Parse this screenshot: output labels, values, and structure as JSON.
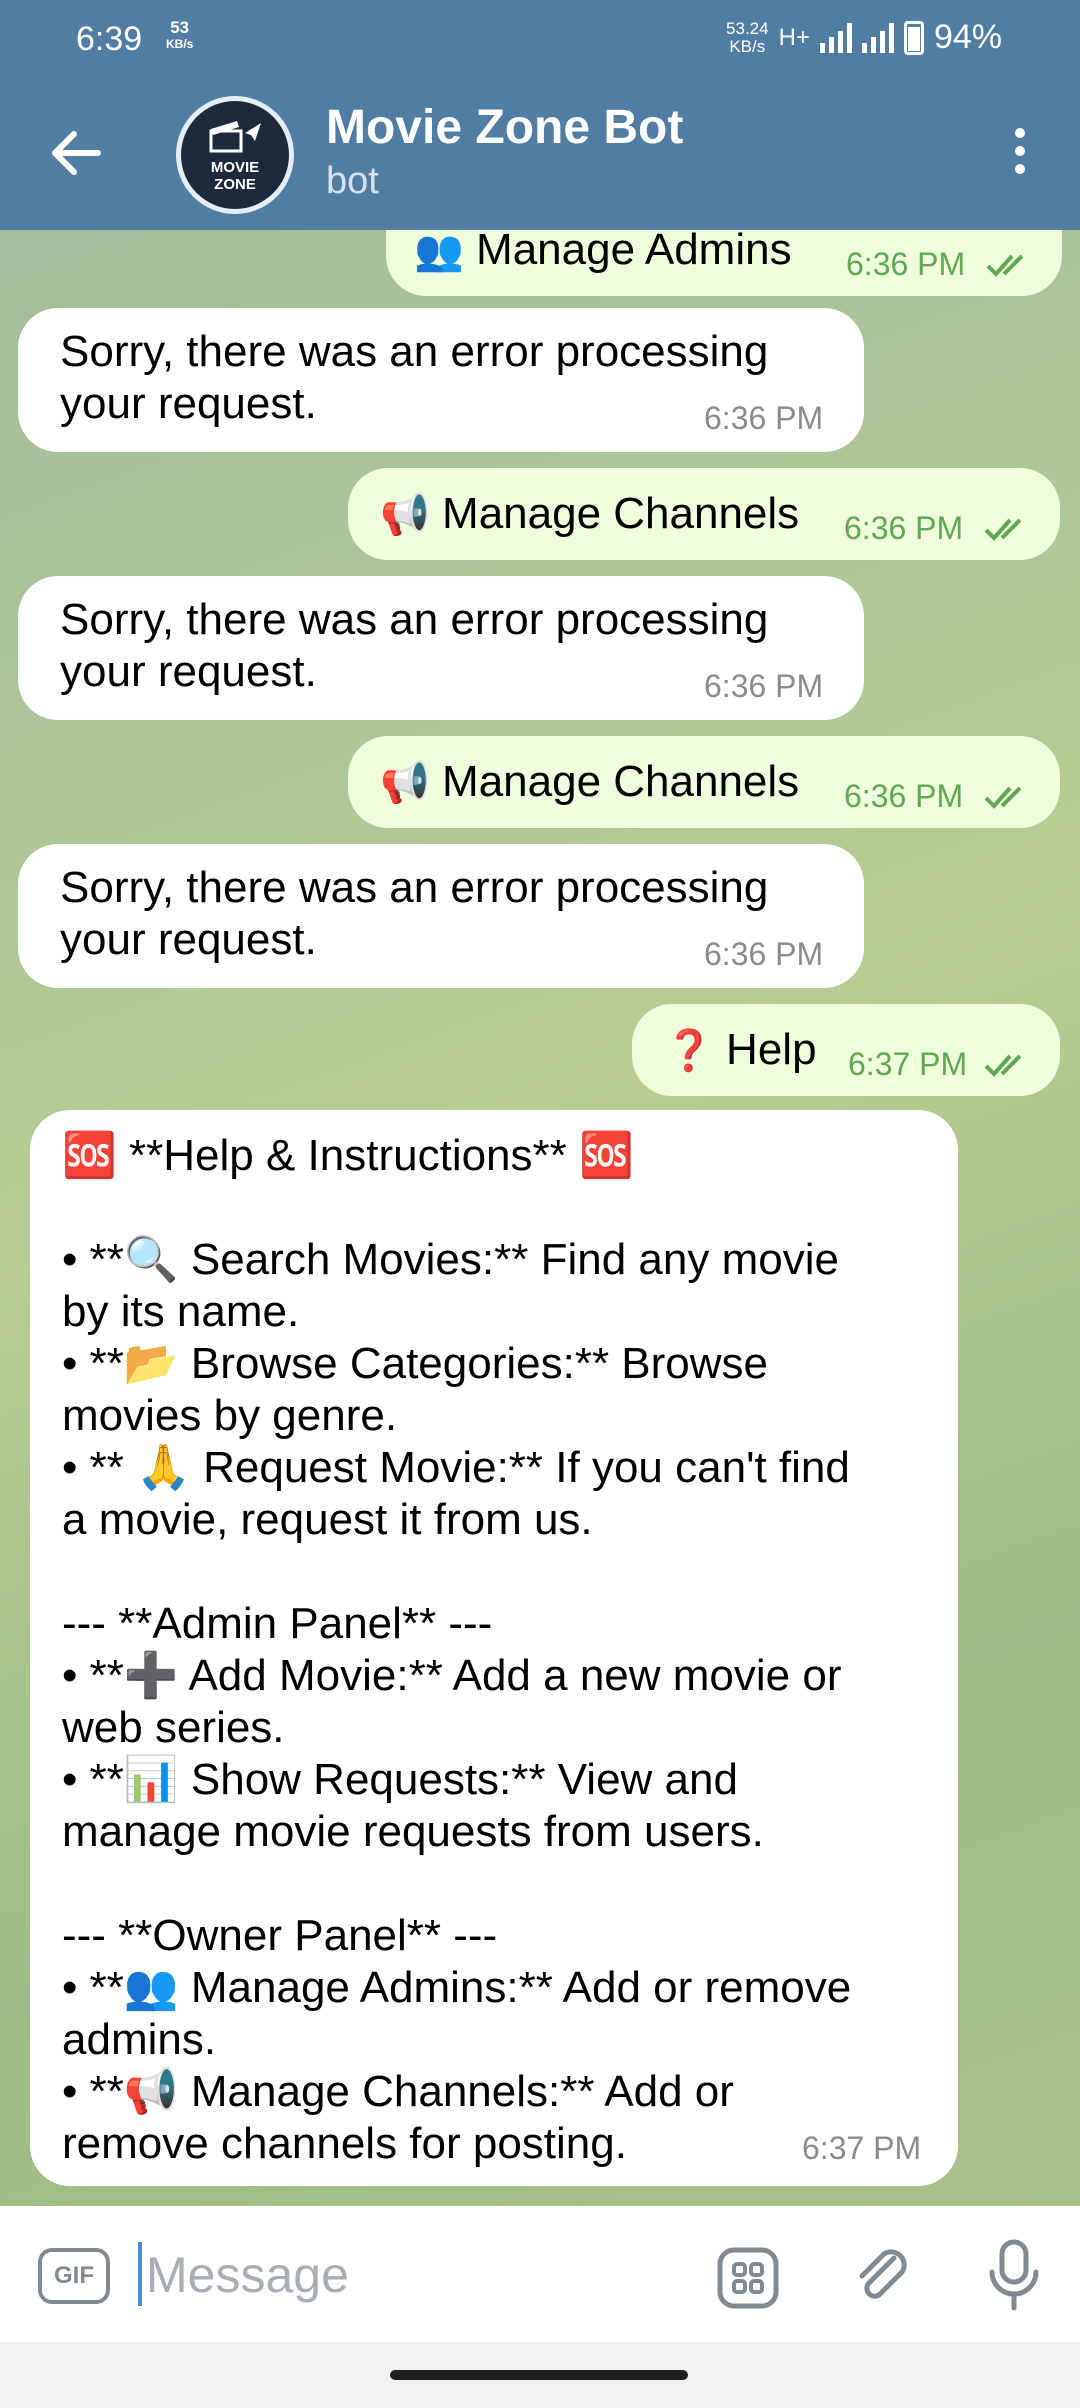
{
  "status_bar": {
    "time": "6:39",
    "speed_value": "53",
    "speed_unit": "KB/s",
    "net_speed_value": "53.24",
    "net_speed_unit": "KB/s",
    "network_type": "H+",
    "battery": "94%"
  },
  "header": {
    "title": "Movie Zone Bot",
    "subtitle": "bot",
    "avatar_line1": "MOVIE",
    "avatar_line2": "ZONE"
  },
  "messages": [
    {
      "type": "out",
      "emoji": "👥",
      "text": "Manage Admins",
      "time": "6:36 PM"
    },
    {
      "type": "in",
      "line1": "Sorry, there was an error processing",
      "line2": "your request.",
      "time": "6:36 PM"
    },
    {
      "type": "out",
      "emoji": "📢",
      "text": "Manage Channels",
      "time": "6:36 PM"
    },
    {
      "type": "in",
      "line1": "Sorry, there was an error processing",
      "line2": "your request.",
      "time": "6:36 PM"
    },
    {
      "type": "out",
      "emoji": "📢",
      "text": "Manage Channels",
      "time": "6:36 PM"
    },
    {
      "type": "in",
      "line1": "Sorry, there was an error processing",
      "line2": "your request.",
      "time": "6:36 PM"
    },
    {
      "type": "out",
      "emoji": "❓",
      "text": "Help",
      "time": "6:37 PM"
    }
  ],
  "help_message": {
    "lines": [
      "🆘 **Help & Instructions** 🆘",
      "",
      "• **🔍 Search Movies:** Find any movie",
      "by its name.",
      "• **📂 Browse Categories:** Browse",
      "movies by genre.",
      "• ** 🙏 Request Movie:** If you can't find",
      "a movie, request it from us.",
      "",
      "--- **Admin Panel** ---",
      "• **➕ Add Movie:** Add a new movie or",
      "web series.",
      "• **📊 Show Requests:** View and",
      "manage movie requests from users.",
      "",
      "--- **Owner Panel** ---",
      "• **👥 Manage Admins:** Add or remove",
      "admins.",
      "• **📢 Manage Channels:** Add or",
      "remove channels for posting."
    ],
    "time": "6:37 PM"
  },
  "input": {
    "gif_label": "GIF",
    "placeholder": "Message"
  },
  "icons": {
    "back": "arrow-left",
    "menu": "more-vert",
    "sticker": "apps-grid",
    "attach": "paperclip",
    "mic": "microphone",
    "read": "double-check"
  },
  "colors": {
    "header": "#527da3",
    "incoming_bubble": "#ffffff",
    "outgoing_bubble": "#effedd",
    "outgoing_time": "#5fa84f"
  }
}
